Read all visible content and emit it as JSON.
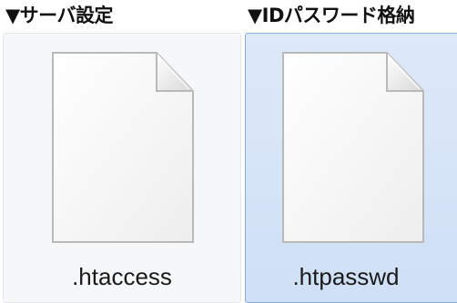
{
  "sections": [
    {
      "label": "▼サーバ設定"
    },
    {
      "label": "▼IDパスワード格納"
    }
  ],
  "files": [
    {
      "name": ".htaccess",
      "icon": "blank-document-icon",
      "selected": false
    },
    {
      "name": ".htpasswd",
      "icon": "blank-document-icon",
      "selected": true
    }
  ],
  "colors": {
    "selection_fill": "#cfe0f6",
    "selection_border": "#84acdd",
    "tile_fill": "#f6f7f9"
  }
}
